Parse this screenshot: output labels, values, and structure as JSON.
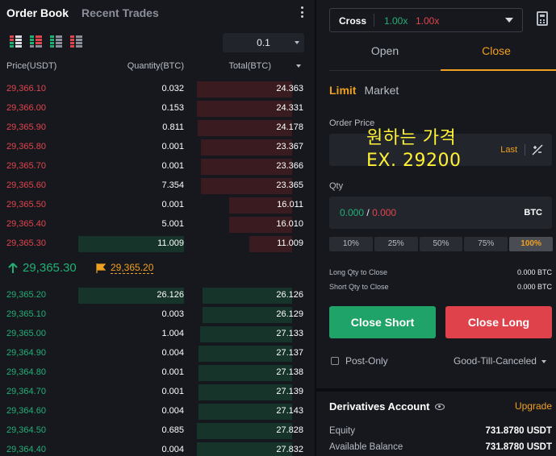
{
  "orderbook": {
    "tabs": [
      "Order Book",
      "Recent Trades"
    ],
    "precision": "0.1",
    "headers": {
      "price": "Price(USDT)",
      "quantity": "Quantity(BTC)",
      "total": "Total(BTC)"
    },
    "asks": [
      {
        "price": "29,366.10",
        "qty": "0.032",
        "total": "24.363",
        "depth": 1.0,
        "qtyDepth": 0
      },
      {
        "price": "29,366.00",
        "qty": "0.153",
        "total": "24.331",
        "depth": 1.0,
        "qtyDepth": 0
      },
      {
        "price": "29,365.90",
        "qty": "0.811",
        "total": "24.178",
        "depth": 0.99,
        "qtyDepth": 0
      },
      {
        "price": "29,365.80",
        "qty": "0.001",
        "total": "23.367",
        "depth": 0.96,
        "qtyDepth": 0
      },
      {
        "price": "29,365.70",
        "qty": "0.001",
        "total": "23.366",
        "depth": 0.96,
        "qtyDepth": 0
      },
      {
        "price": "29,365.60",
        "qty": "7.354",
        "total": "23.365",
        "depth": 0.96,
        "qtyDepth": 0
      },
      {
        "price": "29,365.50",
        "qty": "0.001",
        "total": "16.011",
        "depth": 0.66,
        "qtyDepth": 0
      },
      {
        "price": "29,365.40",
        "qty": "5.001",
        "total": "16.010",
        "depth": 0.66,
        "qtyDepth": 0
      },
      {
        "price": "29,365.30",
        "qty": "11.009",
        "total": "11.009",
        "depth": 0.45,
        "qtyDepth": 1.0
      }
    ],
    "last_price": "29,365.30",
    "mark_price": "29,365.20",
    "bids": [
      {
        "price": "29,365.20",
        "qty": "26.126",
        "total": "26.126",
        "depth": 0.94,
        "qtyDepth": 1.0
      },
      {
        "price": "29,365.10",
        "qty": "0.003",
        "total": "26.129",
        "depth": 0.94,
        "qtyDepth": 0
      },
      {
        "price": "29,365.00",
        "qty": "1.004",
        "total": "27.133",
        "depth": 0.97,
        "qtyDepth": 0
      },
      {
        "price": "29,364.90",
        "qty": "0.004",
        "total": "27.137",
        "depth": 0.98,
        "qtyDepth": 0
      },
      {
        "price": "29,364.80",
        "qty": "0.001",
        "total": "27.138",
        "depth": 0.98,
        "qtyDepth": 0
      },
      {
        "price": "29,364.70",
        "qty": "0.001",
        "total": "27.139",
        "depth": 0.98,
        "qtyDepth": 0
      },
      {
        "price": "29,364.60",
        "qty": "0.004",
        "total": "27.143",
        "depth": 0.98,
        "qtyDepth": 0
      },
      {
        "price": "29,364.50",
        "qty": "0.685",
        "total": "27.828",
        "depth": 1.0,
        "qtyDepth": 0
      },
      {
        "price": "29,364.40",
        "qty": "0.004",
        "total": "27.832",
        "depth": 1.0,
        "qtyDepth": 0
      }
    ]
  },
  "trade": {
    "margin_mode": "Cross",
    "leverage_long": "1.00x",
    "leverage_short": "1.00x",
    "tabs": {
      "open": "Open",
      "close": "Close"
    },
    "order_types": [
      "Limit",
      "Market"
    ],
    "order_price_label": "Order Price",
    "last_button": "Last",
    "overlay_line1": "원하는 가격",
    "overlay_line2": "EX. 29200",
    "qty_label": "Qty",
    "qty_value_1": "0.000",
    "qty_slash": "/",
    "qty_value_2": "0.000",
    "qty_unit": "BTC",
    "percentages": [
      "10%",
      "25%",
      "50%",
      "75%",
      "100%"
    ],
    "long_qty_label": "Long Qty to Close",
    "long_qty_value": "0.000 BTC",
    "short_qty_label": "Short Qty to Close",
    "short_qty_value": "0.000 BTC",
    "close_short": "Close Short",
    "close_long": "Close Long",
    "post_only": "Post-Only",
    "time_in_force": "Good-Till-Canceled"
  },
  "account": {
    "title": "Derivatives Account",
    "upgrade": "Upgrade",
    "equity_label": "Equity",
    "equity_value": "731.8780 USDT",
    "available_label": "Available Balance",
    "available_value": "731.8780 USDT"
  },
  "colors": {
    "ask": "#e0454d",
    "bid": "#21b074",
    "accent": "#f0a020",
    "ask_bar": "#3a1c20",
    "bid_bar": "#16342a"
  }
}
